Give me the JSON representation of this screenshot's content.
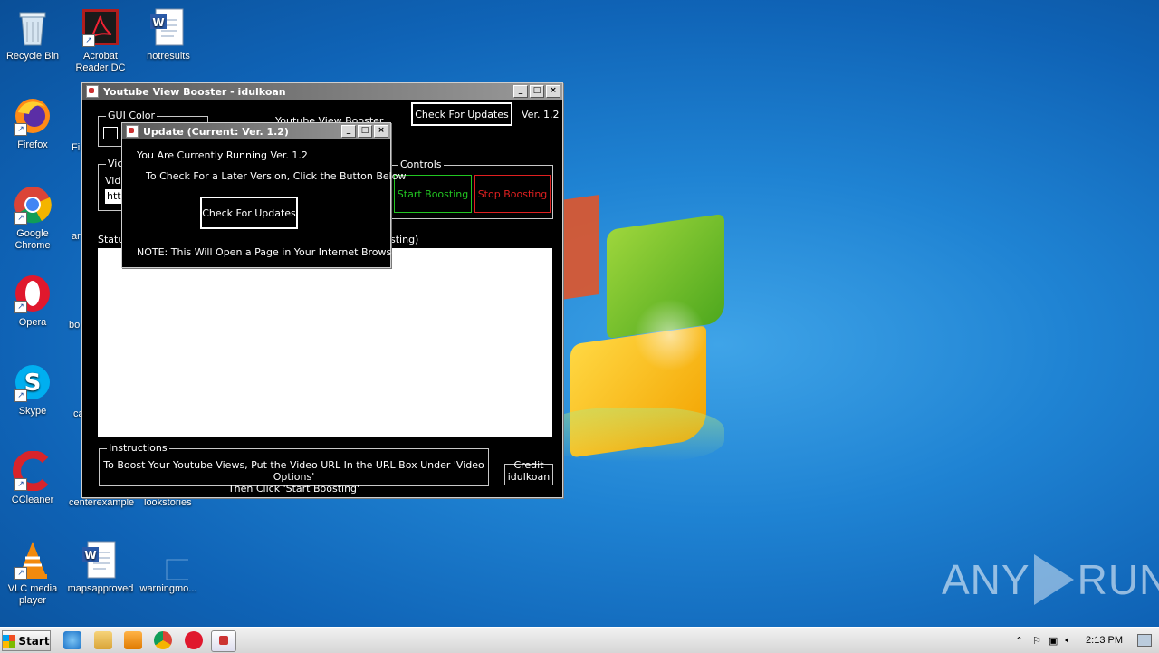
{
  "desktop": {
    "icons": [
      {
        "label": "Recycle Bin",
        "icon": "recycle-bin-icon"
      },
      {
        "label": "Acrobat Reader DC",
        "icon": "acrobat-icon"
      },
      {
        "label": "notresults",
        "icon": "word-doc-icon"
      },
      {
        "label": "Firefox",
        "icon": "firefox-icon"
      },
      {
        "label": "Google Chrome",
        "icon": "chrome-icon"
      },
      {
        "label": "Opera",
        "icon": "opera-icon"
      },
      {
        "label": "Skype",
        "icon": "skype-icon"
      },
      {
        "label": "CCleaner",
        "icon": "ccleaner-icon"
      },
      {
        "label": "VLC media player",
        "icon": "vlc-icon"
      },
      {
        "label": "mapsapproved",
        "icon": "word-doc-icon"
      }
    ],
    "partial_labels": [
      "Fi",
      "ar",
      "bo",
      "ca",
      "centerexample",
      "lookstories",
      "warningmo..."
    ],
    "watermark": "ANY RUN"
  },
  "main_window": {
    "title": "Youtube View Booster - idulkoan",
    "gui_color_legend": "GUI Color",
    "app_name_label": "Youtube View Booster",
    "check_updates_button": "Check For Updates",
    "version_label": "Ver. 1.2",
    "video_group_legend": "Vic",
    "video_label": "Vid",
    "url_field_value": "htt",
    "controls_legend": "Controls",
    "start_button": "Start Boosting",
    "stop_button": "Stop Boosting",
    "status_label": "Statu",
    "status_suffix": "sting)",
    "instructions_legend": "Instructions",
    "instructions_line1": "To Boost Your Youtube Views, Put the Video URL In the URL Box Under 'Video Options'",
    "instructions_line2": "Then Click 'Start Boosting'",
    "credit_label": "Credit",
    "credit_name": "idulkoan"
  },
  "update_dialog": {
    "title": "Update (Current: Ver. 1.2)",
    "line1": "You Are Currently Running Ver. 1.2",
    "line2": "To Check For a Later Version, Click the Button Below",
    "button": "Check For Updates",
    "note": "NOTE: This Will Open a Page in Your Internet Browser"
  },
  "taskbar": {
    "start_label": "Start",
    "clock": "2:13 PM"
  },
  "colors": {
    "start_button": "#22c622",
    "stop_button": "#e02020",
    "window_bg": "#000000"
  }
}
